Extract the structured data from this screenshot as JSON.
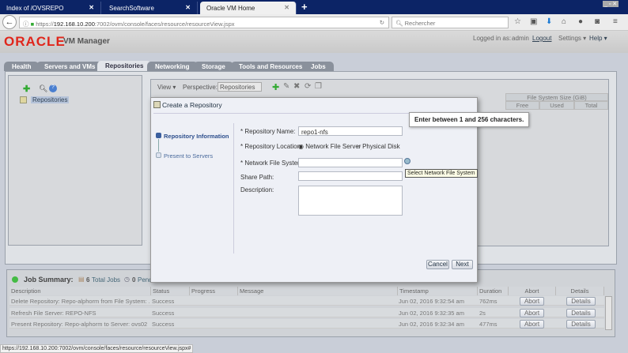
{
  "browser": {
    "tabs": [
      {
        "label": "Index of /OVSREPO"
      },
      {
        "label": "SearchSoftware"
      },
      {
        "label": "Oracle VM Home"
      }
    ],
    "url_prefix": "https://",
    "url_host": "192.168.10.200",
    "url_path": ":7002/ovm/console/faces/resource/resourceView.jspx",
    "search_placeholder": "Rechercher",
    "status_url": "https://192.168.10.200:7002/ovm/console/faces/resource/resourceView.jspx#"
  },
  "header": {
    "logo": "ORACLE",
    "title": "VM Manager",
    "logged_in_label": "Logged in as:",
    "user": "admin",
    "logout": "Logout",
    "settings": "Settings ▾",
    "help": "Help ▾"
  },
  "main_tabs": [
    "Health",
    "Servers and VMs",
    "Repositories",
    "Networking",
    "Storage",
    "Tools and Resources",
    "Jobs"
  ],
  "left_panel": {
    "tree_item": "Repositories"
  },
  "toolbar": {
    "view": "View ▾",
    "perspective_label": "Perspective:",
    "perspective_value": "Repositories"
  },
  "table_header": {
    "group": "File System Size (GiB)",
    "free": "Free",
    "used": "Used",
    "total": "Total"
  },
  "dialog": {
    "title": "Create a Repository",
    "steps": [
      "Repository Information",
      "Present to Servers"
    ],
    "name_label": "* Repository Name:",
    "name_value": "repo1-nfs",
    "location_label": "* Repository Location:",
    "opt_nfs": "Network File Server",
    "opt_disk": "Physical Disk",
    "nfs_label": "* Network File System:",
    "share_label": "Share Path:",
    "desc_label": "Description:",
    "cancel": "Cancel",
    "next": "Next",
    "tooltip": "Enter between 1 and 256 characters.",
    "select_tooltip": "Select Network File System"
  },
  "jobs": {
    "title": "Job Summary:",
    "total_count": "6",
    "total_label": "Total Jobs",
    "pending_count": "0",
    "pending_label": "Pend",
    "columns": [
      "Description",
      "Status",
      "Progress",
      "Message",
      "Timestamp",
      "Duration",
      "Abort",
      "Details"
    ],
    "rows": [
      {
        "description": "Delete Repository: Repo-alphorm from File System: ...",
        "status": "Success",
        "timestamp": "Jun 02, 2016 9:32:54 am",
        "duration": "762ms",
        "abort": "Abort",
        "details": "Details"
      },
      {
        "description": "Refresh File Server: REPO-NFS",
        "status": "Success",
        "timestamp": "Jun 02, 2016 9:32:35 am",
        "duration": "2s",
        "abort": "Abort",
        "details": "Details"
      },
      {
        "description": "Present Repository: Repo-alphorm to Server: ovs02",
        "status": "Success",
        "timestamp": "Jun 02, 2016 9:32:34 am",
        "duration": "477ms",
        "abort": "Abort",
        "details": "Details"
      }
    ]
  }
}
